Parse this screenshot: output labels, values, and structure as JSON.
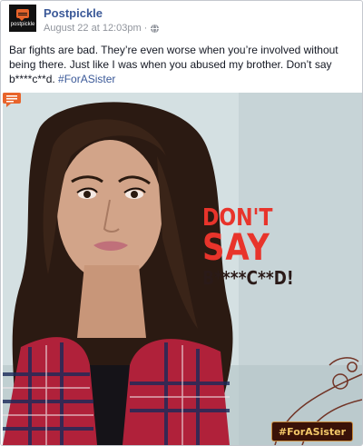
{
  "post": {
    "page_name": "Postpickle",
    "timestamp": "August 22 at 12:03pm",
    "separator": "·",
    "privacy_icon": "globe-icon",
    "text_body": "Bar fights are bad. They’re even worse when you’re involved without being there. Just like I was when you abused my brother. Don’t say b****c**d. ",
    "hashtag": "#ForASister"
  },
  "avatar": {
    "logo_text": "postpickle",
    "icon": "speech-bubble-icon"
  },
  "image": {
    "slogan_line1": "DON'T",
    "slogan_line2": "SAY",
    "slogan_line3": "B****C**D!",
    "badge_text": "#ForASister",
    "corner_logo_icon": "speech-bubble-icon"
  },
  "colors": {
    "link": "#3b5998",
    "meta": "#90949c",
    "brand_orange": "#e8642b",
    "slogan_red": "#e8342b"
  }
}
